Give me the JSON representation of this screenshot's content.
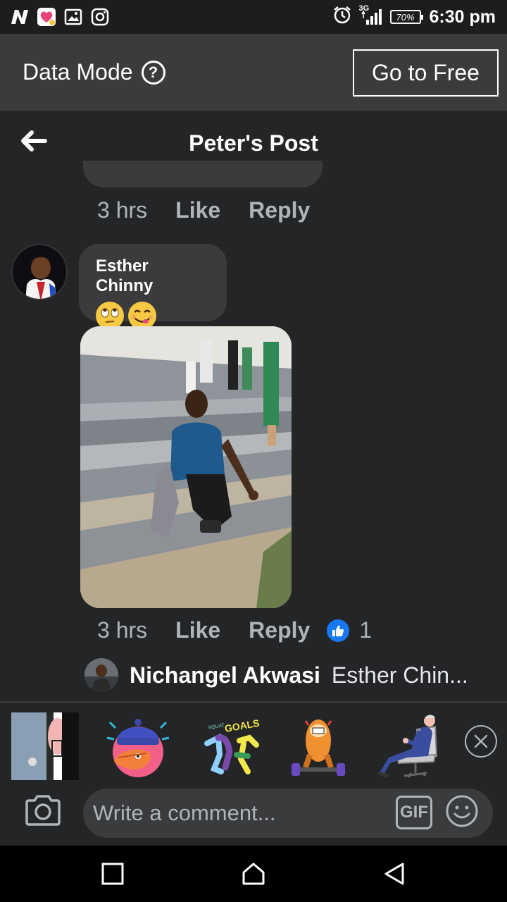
{
  "status_bar": {
    "time": "6:30 pm",
    "battery": "70%",
    "network": "3G",
    "left_icons": [
      "n-app-icon",
      "heart-app-icon",
      "gallery-icon",
      "instagram-icon"
    ],
    "right_icons": [
      "alarm-icon",
      "signal-icon",
      "battery-icon"
    ]
  },
  "data_mode": {
    "label": "Data Mode",
    "help_glyph": "?",
    "cta": "Go to Free"
  },
  "header": {
    "title": "Peter's Post"
  },
  "previous_comment": {
    "time": "3 hrs",
    "like": "Like",
    "reply": "Reply"
  },
  "comment": {
    "author": "Esther Chinny",
    "emojis": [
      "face-with-rolling-eyes",
      "face-savoring-food"
    ],
    "time": "3 hrs",
    "like": "Like",
    "reply": "Reply",
    "reaction_count": "1"
  },
  "reply_preview": {
    "name": "Nichangel Akwasi",
    "text": "Esther Chin..."
  },
  "stickers": {
    "items": [
      "door-peek-sticker",
      "facepalm-sticker",
      "squat-goals-sticker",
      "weightlift-sticker",
      "chair-man-sticker"
    ],
    "sticker_text": "GOALS",
    "sticker_text_small": "SQUAT"
  },
  "composer": {
    "placeholder": "Write a comment...",
    "gif": "GIF"
  },
  "colors": {
    "background": "#242526",
    "bubble": "#3a3b3c",
    "accent": "#1877f2",
    "muted": "#b0b3b8"
  }
}
